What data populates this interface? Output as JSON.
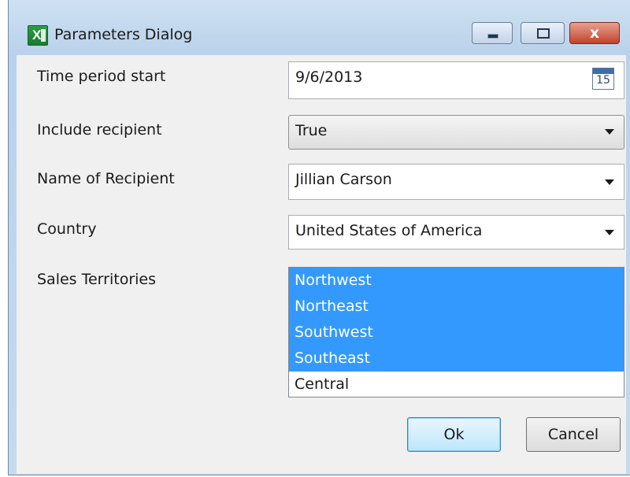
{
  "window": {
    "title": "Parameters Dialog",
    "app_icon": "excel-icon",
    "caption_buttons": [
      "minimize",
      "maximize",
      "close"
    ],
    "close_glyph": "x"
  },
  "params": {
    "time_period_start": {
      "label": "Time period start",
      "value": "9/6/2013",
      "calendar_day": "15"
    },
    "include_recipient": {
      "label": "Include recipient",
      "value": "True"
    },
    "name_of_recipient": {
      "label": "Name of Recipient",
      "value": "Jillian Carson"
    },
    "country": {
      "label": "Country",
      "value": "United States of America"
    },
    "sales_territories": {
      "label": "Sales Territories",
      "items": [
        {
          "text": "Northwest",
          "selected": true
        },
        {
          "text": "Northeast",
          "selected": true
        },
        {
          "text": "Southwest",
          "selected": true
        },
        {
          "text": "Southeast",
          "selected": true
        },
        {
          "text": "Central",
          "selected": false
        }
      ]
    }
  },
  "buttons": {
    "ok": "Ok",
    "cancel": "Cancel"
  },
  "colors": {
    "selection": "#3399ff",
    "window_frame": "#b9d1ea"
  }
}
